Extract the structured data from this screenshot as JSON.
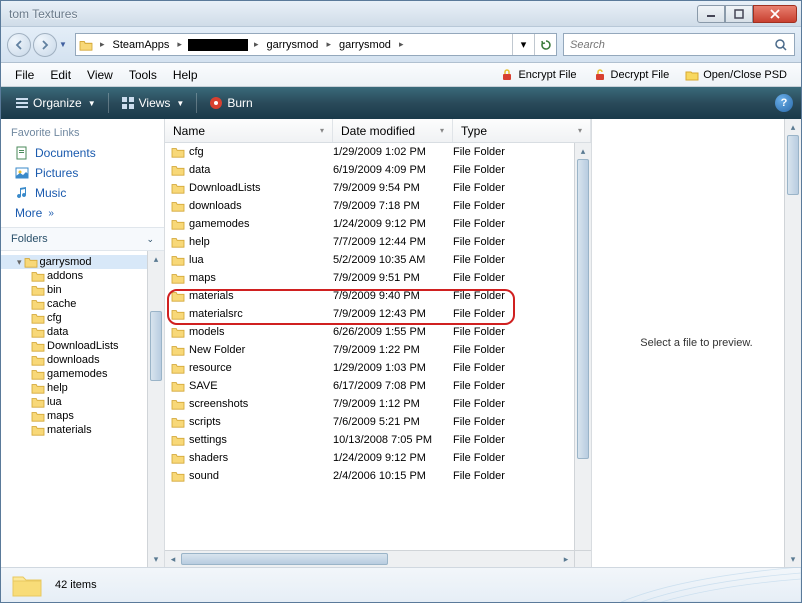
{
  "window": {
    "title": "tom Textures"
  },
  "breadcrumb": {
    "segments": [
      "SteamApps",
      "garrysmod",
      "garrysmod"
    ],
    "redacted_index": 1
  },
  "search": {
    "placeholder": "Search"
  },
  "menu": {
    "file": "File",
    "edit": "Edit",
    "view": "View",
    "tools": "Tools",
    "help": "Help",
    "encrypt": "Encrypt File",
    "decrypt": "Decrypt File",
    "psd": "Open/Close PSD"
  },
  "toolbar": {
    "organize": "Organize",
    "views": "Views",
    "burn": "Burn"
  },
  "fav": {
    "header": "Favorite Links",
    "docs": "Documents",
    "pics": "Pictures",
    "music": "Music",
    "more": "More"
  },
  "folders": {
    "header": "Folders"
  },
  "tree": {
    "root": "garrysmod",
    "items": [
      "addons",
      "bin",
      "cache",
      "cfg",
      "data",
      "DownloadLists",
      "downloads",
      "gamemodes",
      "help",
      "lua",
      "maps",
      "materials"
    ]
  },
  "columns": {
    "name": "Name",
    "date": "Date modified",
    "type": "Type"
  },
  "files": [
    {
      "name": "cfg",
      "date": "1/29/2009 1:02 PM",
      "type": "File Folder"
    },
    {
      "name": "data",
      "date": "6/19/2009 4:09 PM",
      "type": "File Folder"
    },
    {
      "name": "DownloadLists",
      "date": "7/9/2009 9:54 PM",
      "type": "File Folder"
    },
    {
      "name": "downloads",
      "date": "7/9/2009 7:18 PM",
      "type": "File Folder"
    },
    {
      "name": "gamemodes",
      "date": "1/24/2009 9:12 PM",
      "type": "File Folder"
    },
    {
      "name": "help",
      "date": "7/7/2009 12:44 PM",
      "type": "File Folder"
    },
    {
      "name": "lua",
      "date": "5/2/2009 10:35 AM",
      "type": "File Folder"
    },
    {
      "name": "maps",
      "date": "7/9/2009 9:51 PM",
      "type": "File Folder"
    },
    {
      "name": "materials",
      "date": "7/9/2009 9:40 PM",
      "type": "File Folder"
    },
    {
      "name": "materialsrc",
      "date": "7/9/2009 12:43 PM",
      "type": "File Folder"
    },
    {
      "name": "models",
      "date": "6/26/2009 1:55 PM",
      "type": "File Folder"
    },
    {
      "name": "New Folder",
      "date": "7/9/2009 1:22 PM",
      "type": "File Folder"
    },
    {
      "name": "resource",
      "date": "1/29/2009 1:03 PM",
      "type": "File Folder"
    },
    {
      "name": "SAVE",
      "date": "6/17/2009 7:08 PM",
      "type": "File Folder"
    },
    {
      "name": "screenshots",
      "date": "7/9/2009 1:12 PM",
      "type": "File Folder"
    },
    {
      "name": "scripts",
      "date": "7/6/2009 5:21 PM",
      "type": "File Folder"
    },
    {
      "name": "settings",
      "date": "10/13/2008 7:05 PM",
      "type": "File Folder"
    },
    {
      "name": "shaders",
      "date": "1/24/2009 9:12 PM",
      "type": "File Folder"
    },
    {
      "name": "sound",
      "date": "2/4/2006 10:15 PM",
      "type": "File Folder"
    }
  ],
  "preview": {
    "text": "Select a file to preview."
  },
  "status": {
    "count": "42 items"
  }
}
